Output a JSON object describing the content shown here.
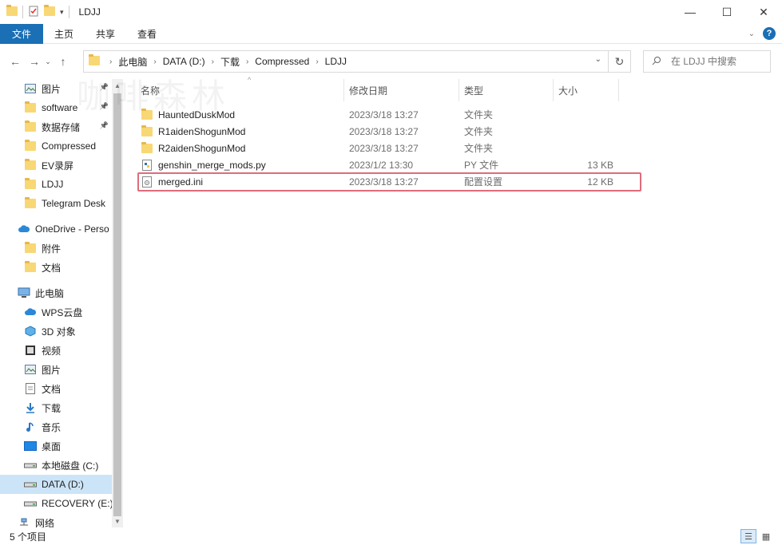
{
  "window": {
    "title": "LDJJ",
    "controls": [
      "minimize",
      "maximize",
      "close"
    ]
  },
  "ribbon": {
    "tabs": [
      {
        "label": "文件",
        "active": true
      },
      {
        "label": "主页"
      },
      {
        "label": "共享"
      },
      {
        "label": "查看"
      }
    ]
  },
  "nav": {
    "breadcrumbs": [
      "此电脑",
      "DATA (D:)",
      "下载",
      "Compressed",
      "LDJJ"
    ],
    "search_placeholder": "在 LDJJ 中搜索"
  },
  "sidebar": {
    "items": [
      {
        "label": "图片",
        "icon": "pictures-icon",
        "pinned": true
      },
      {
        "label": "software",
        "icon": "folder-icon",
        "pinned": true
      },
      {
        "label": "数据存储",
        "icon": "folder-icon",
        "pinned": true
      },
      {
        "label": "Compressed",
        "icon": "folder-icon"
      },
      {
        "label": "EV录屏",
        "icon": "folder-icon"
      },
      {
        "label": "LDJJ",
        "icon": "folder-icon"
      },
      {
        "label": "Telegram Desk",
        "icon": "folder-icon"
      },
      {
        "label": "OneDrive - Perso",
        "icon": "cloud-icon",
        "section": true
      },
      {
        "label": "附件",
        "icon": "folder-icon"
      },
      {
        "label": "文档",
        "icon": "folder-icon"
      },
      {
        "label": "此电脑",
        "icon": "computer-icon",
        "section": true
      },
      {
        "label": "WPS云盘",
        "icon": "cloud-icon"
      },
      {
        "label": "3D 对象",
        "icon": "cube-icon"
      },
      {
        "label": "视频",
        "icon": "video-icon"
      },
      {
        "label": "图片",
        "icon": "pictures-icon"
      },
      {
        "label": "文档",
        "icon": "document-icon"
      },
      {
        "label": "下载",
        "icon": "download-icon"
      },
      {
        "label": "音乐",
        "icon": "music-icon"
      },
      {
        "label": "桌面",
        "icon": "desktop-icon"
      },
      {
        "label": "本地磁盘 (C:)",
        "icon": "drive-icon"
      },
      {
        "label": "DATA (D:)",
        "icon": "drive-icon",
        "selected": true
      },
      {
        "label": "RECOVERY (E:)",
        "icon": "drive-icon"
      },
      {
        "label": "网络",
        "icon": "network-icon",
        "section": true
      }
    ]
  },
  "columns": {
    "name": "名称",
    "date": "修改日期",
    "type": "类型",
    "size": "大小"
  },
  "files": [
    {
      "name": "HauntedDuskMod",
      "date": "2023/3/18 13:27",
      "type": "文件夹",
      "size": "",
      "icon": "folder-icon"
    },
    {
      "name": "R1aidenShogunMod",
      "date": "2023/3/18 13:27",
      "type": "文件夹",
      "size": "",
      "icon": "folder-icon"
    },
    {
      "name": "R2aidenShogunMod",
      "date": "2023/3/18 13:27",
      "type": "文件夹",
      "size": "",
      "icon": "folder-icon"
    },
    {
      "name": "genshin_merge_mods.py",
      "date": "2023/1/2 13:30",
      "type": "PY 文件",
      "size": "13 KB",
      "icon": "python-file-icon"
    },
    {
      "name": "merged.ini",
      "date": "2023/3/18 13:27",
      "type": "配置设置",
      "size": "12 KB",
      "icon": "settings-file-icon",
      "highlighted": true
    }
  ],
  "status": {
    "item_count": "5 个项目"
  },
  "watermark": "咖啡森林",
  "colors": {
    "accent": "#1a6fb5",
    "selection": "#cce4f7",
    "highlight_border": "#e06c7a"
  }
}
